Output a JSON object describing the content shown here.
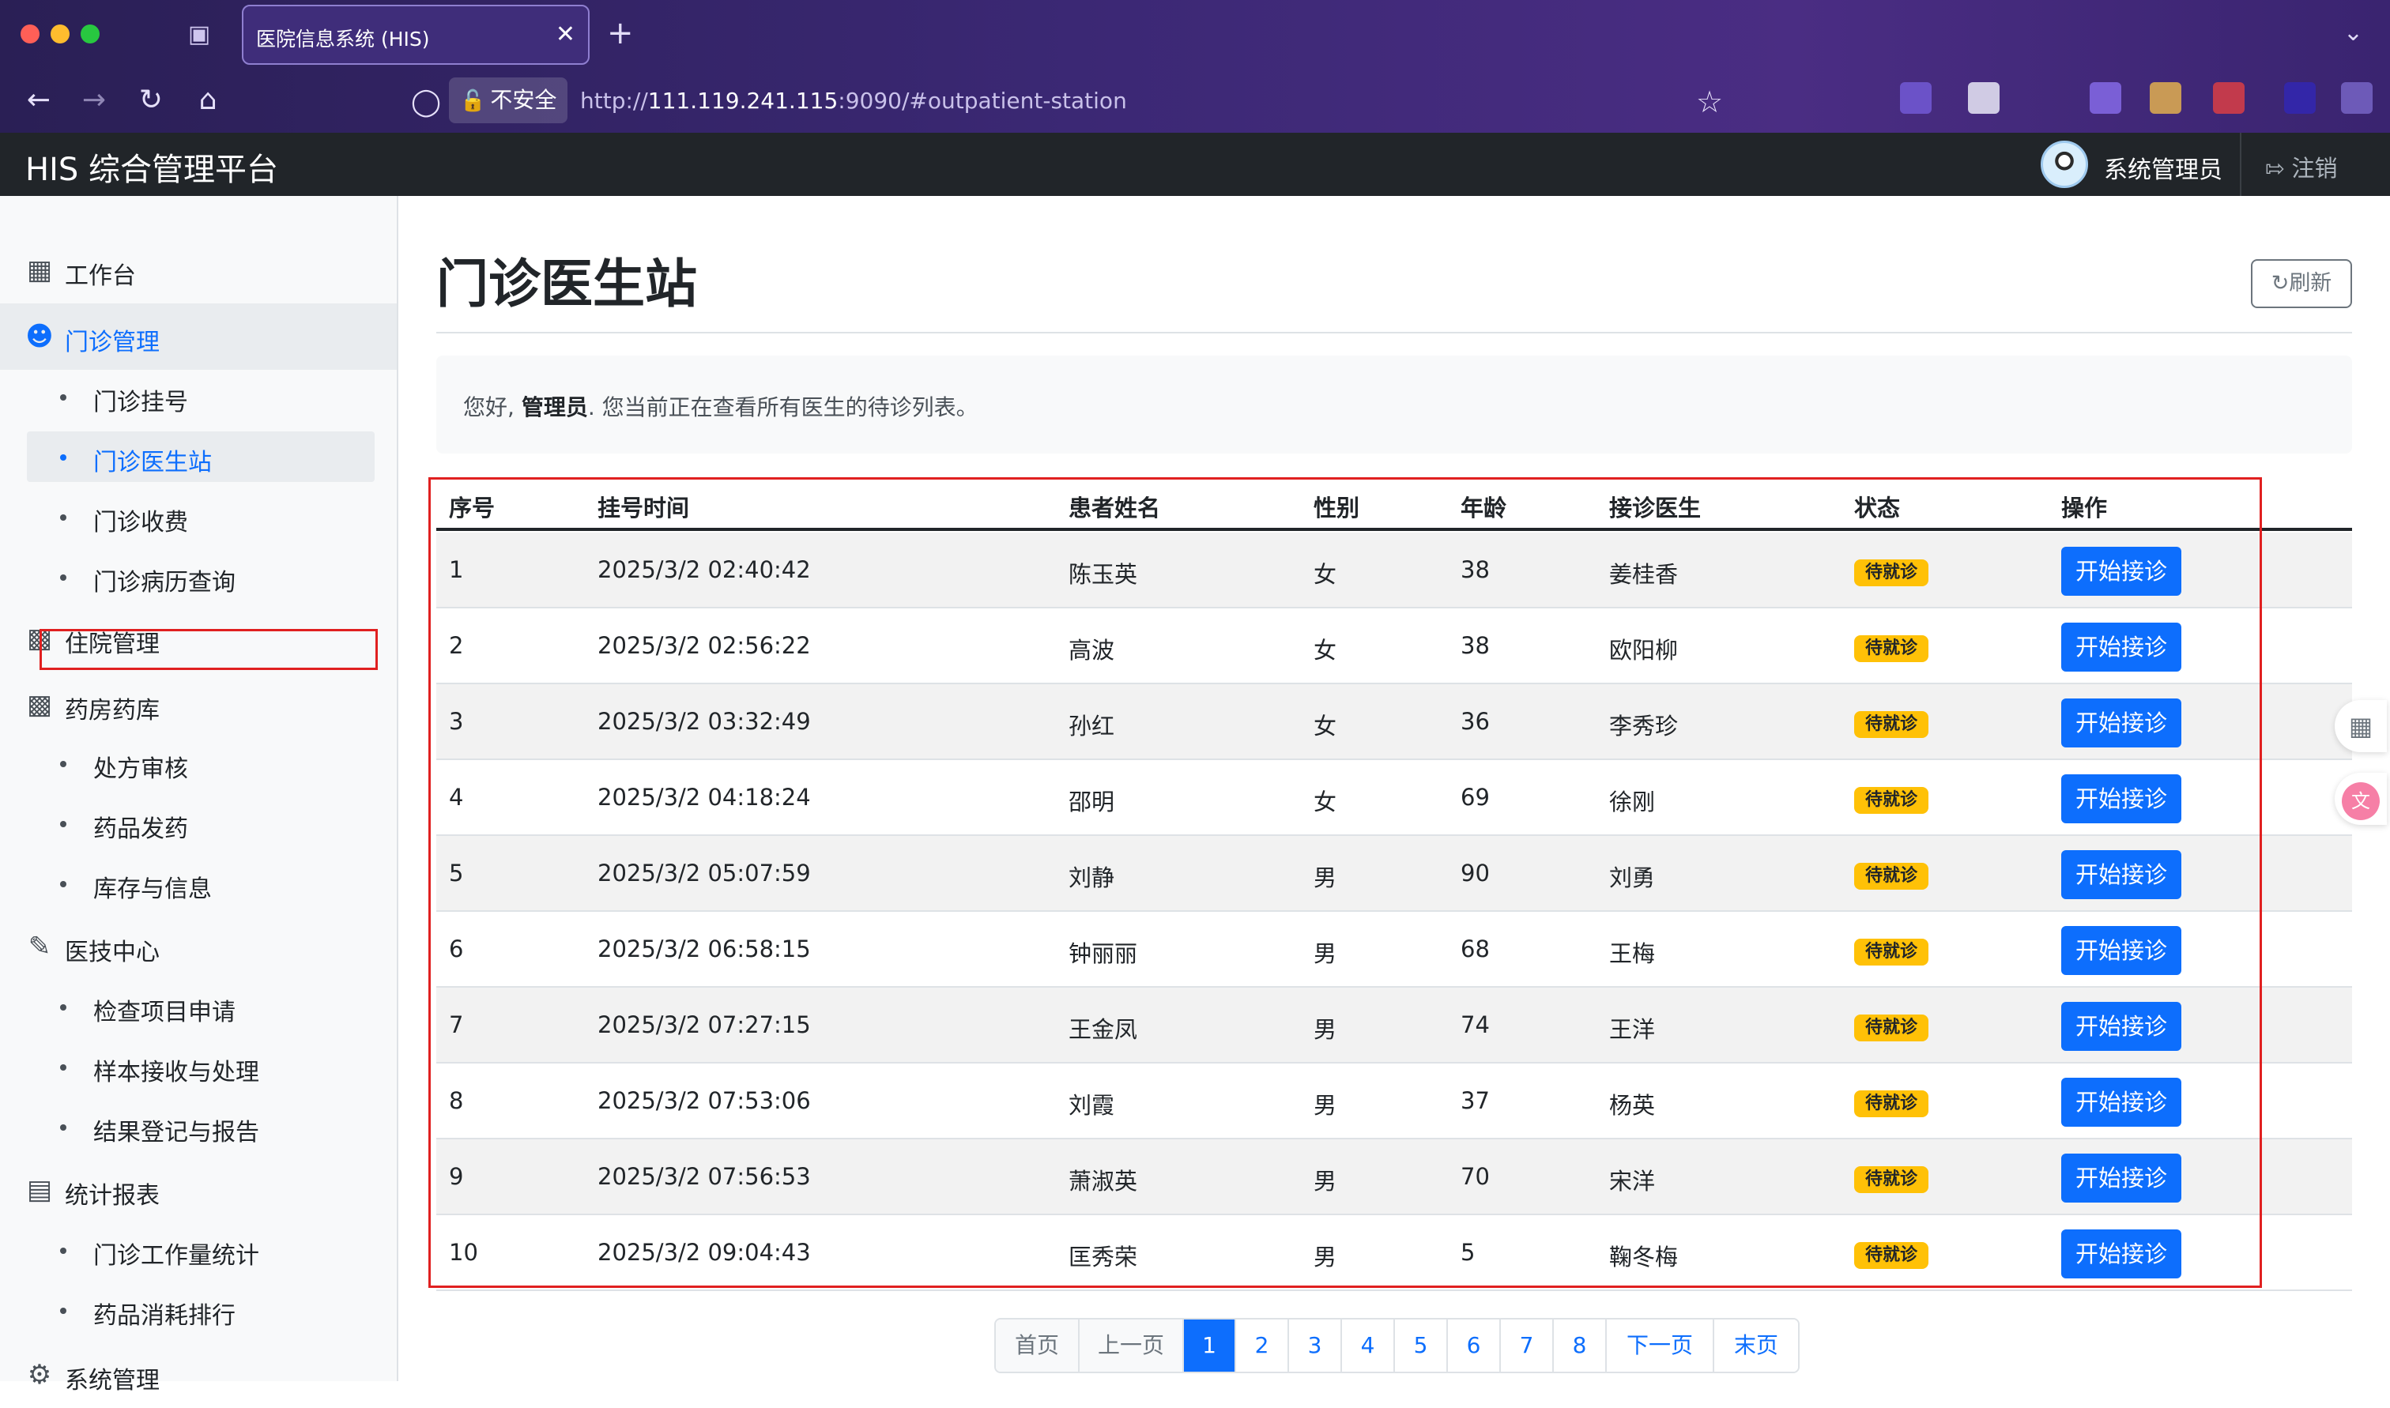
{
  "browser": {
    "tab_title": "医院信息系统 (HIS)",
    "security_label": "不安全",
    "url_scheme": "http://",
    "url_host": "111.119.241.115",
    "url_rest": ":9090/#outpatient-station"
  },
  "header": {
    "brand": "HIS 综合管理平台",
    "user": "系统管理员",
    "logout": "注销"
  },
  "sidebar": {
    "groups": [
      {
        "label": "工作台",
        "icon": "dashboard-icon"
      },
      {
        "label": "门诊管理",
        "icon": "users-icon",
        "items": [
          "门诊挂号",
          "门诊医生站",
          "门诊收费",
          "门诊病历查询"
        ]
      },
      {
        "label": "住院管理",
        "icon": "building-icon"
      },
      {
        "label": "药房药库",
        "icon": "building-icon",
        "items": [
          "处方审核",
          "药品发药",
          "库存与信息"
        ]
      },
      {
        "label": "医技中心",
        "icon": "pen-icon",
        "items": [
          "检查项目申请",
          "样本接收与处理",
          "结果登记与报告"
        ]
      },
      {
        "label": "统计报表",
        "icon": "bar-chart-icon",
        "items": [
          "门诊工作量统计",
          "药品消耗排行"
        ]
      },
      {
        "label": "系统管理",
        "icon": "gear-icon"
      }
    ]
  },
  "main": {
    "title": "门诊医生站",
    "refresh": "刷新",
    "greeting_prefix": "您好, ",
    "greeting_user": "管理员",
    "greeting_suffix": ". 您当前正在查看所有医生的待诊列表。",
    "columns": [
      "序号",
      "挂号时间",
      "患者姓名",
      "性别",
      "年龄",
      "接诊医生",
      "状态",
      "操作"
    ],
    "rows": [
      {
        "no": "1",
        "time": "2025/3/2 02:40:42",
        "name": "陈玉英",
        "sex": "女",
        "age": "38",
        "doctor": "姜桂香",
        "status": "待就诊",
        "action": "开始接诊"
      },
      {
        "no": "2",
        "time": "2025/3/2 02:56:22",
        "name": "高波",
        "sex": "女",
        "age": "38",
        "doctor": "欧阳柳",
        "status": "待就诊",
        "action": "开始接诊"
      },
      {
        "no": "3",
        "time": "2025/3/2 03:32:49",
        "name": "孙红",
        "sex": "女",
        "age": "36",
        "doctor": "李秀珍",
        "status": "待就诊",
        "action": "开始接诊"
      },
      {
        "no": "4",
        "time": "2025/3/2 04:18:24",
        "name": "邵明",
        "sex": "女",
        "age": "69",
        "doctor": "徐刚",
        "status": "待就诊",
        "action": "开始接诊"
      },
      {
        "no": "5",
        "time": "2025/3/2 05:07:59",
        "name": "刘静",
        "sex": "男",
        "age": "90",
        "doctor": "刘勇",
        "status": "待就诊",
        "action": "开始接诊"
      },
      {
        "no": "6",
        "time": "2025/3/2 06:58:15",
        "name": "钟丽丽",
        "sex": "男",
        "age": "68",
        "doctor": "王梅",
        "status": "待就诊",
        "action": "开始接诊"
      },
      {
        "no": "7",
        "time": "2025/3/2 07:27:15",
        "name": "王金凤",
        "sex": "男",
        "age": "74",
        "doctor": "王洋",
        "status": "待就诊",
        "action": "开始接诊"
      },
      {
        "no": "8",
        "time": "2025/3/2 07:53:06",
        "name": "刘霞",
        "sex": "男",
        "age": "37",
        "doctor": "杨英",
        "status": "待就诊",
        "action": "开始接诊"
      },
      {
        "no": "9",
        "time": "2025/3/2 07:56:53",
        "name": "萧淑英",
        "sex": "男",
        "age": "70",
        "doctor": "宋洋",
        "status": "待就诊",
        "action": "开始接诊"
      },
      {
        "no": "10",
        "time": "2025/3/2 09:04:43",
        "name": "匡秀荣",
        "sex": "男",
        "age": "5",
        "doctor": "鞠冬梅",
        "status": "待就诊",
        "action": "开始接诊"
      }
    ]
  },
  "pagination": {
    "first": "首页",
    "prev": "上一页",
    "pages": [
      "1",
      "2",
      "3",
      "4",
      "5",
      "6",
      "7",
      "8"
    ],
    "current": "1",
    "next": "下一页",
    "last": "末页"
  },
  "colors": {
    "primary": "#0d6efd",
    "warning": "#ffc107",
    "dark_header": "#212529",
    "highlight_border": "#e02020"
  }
}
